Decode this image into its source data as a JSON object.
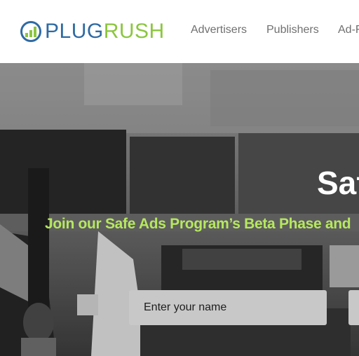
{
  "header": {
    "logo": {
      "part1": "PLUG",
      "part2": "RUSH",
      "icon": "bar-chart-circle-icon",
      "colors": {
        "plug": "#2f6aa3",
        "rush": "#8cc63f"
      }
    },
    "nav": [
      {
        "label": "Advertisers"
      },
      {
        "label": "Publishers"
      },
      {
        "label": "Ad-F"
      }
    ]
  },
  "hero": {
    "title": "Saf",
    "subtitle": "Join our Safe Ads Program’s Beta Phase and",
    "subtitle_color": "#b6e85e",
    "form": {
      "name_placeholder": "Enter your name",
      "name_value": ""
    }
  }
}
